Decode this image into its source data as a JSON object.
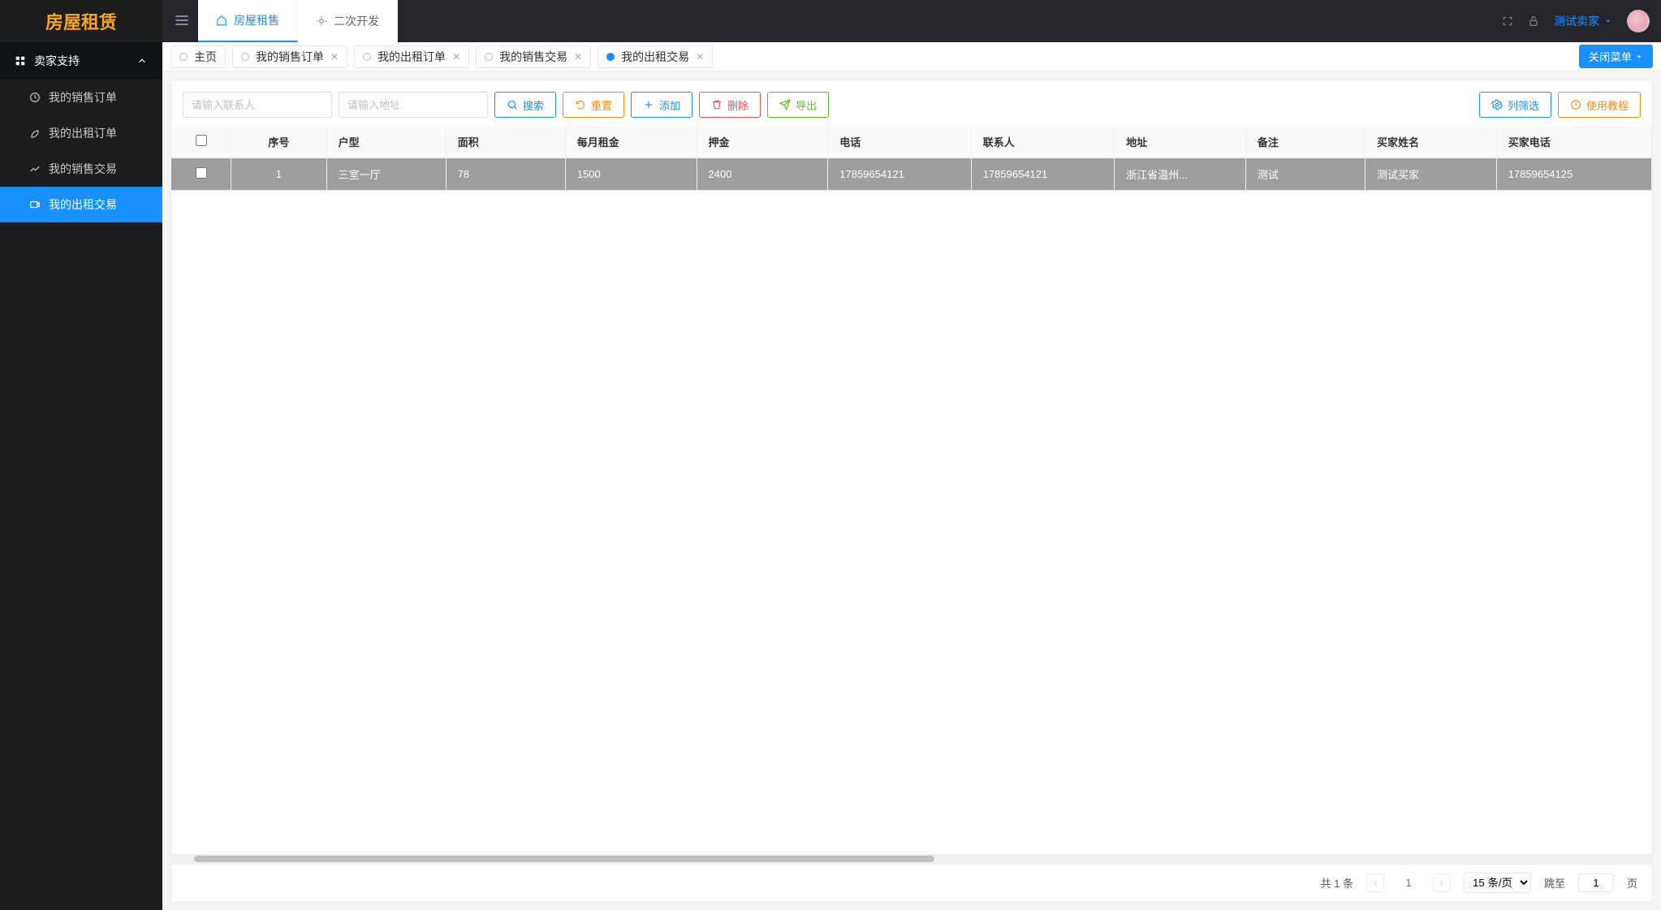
{
  "logo": "房屋租赁",
  "sidebar": {
    "group_label": "卖家支持",
    "items": [
      {
        "label": "我的销售订单"
      },
      {
        "label": "我的出租订单"
      },
      {
        "label": "我的销售交易"
      },
      {
        "label": "我的出租交易"
      }
    ]
  },
  "topnav": {
    "tabs": [
      {
        "label": "房屋租售",
        "active": true
      },
      {
        "label": "二次开发",
        "active": false
      }
    ]
  },
  "user": {
    "name": "测试卖家"
  },
  "pagetabs": {
    "close_menu": "关闭菜单",
    "items": [
      {
        "label": "主页",
        "closable": false
      },
      {
        "label": "我的销售订单",
        "closable": true
      },
      {
        "label": "我的出租订单",
        "closable": true
      },
      {
        "label": "我的销售交易",
        "closable": true
      },
      {
        "label": "我的出租交易",
        "closable": true,
        "active": true
      }
    ]
  },
  "search": {
    "contact_placeholder": "请输入联系人",
    "address_placeholder": "请输入地址"
  },
  "buttons": {
    "search": "搜索",
    "reset": "重置",
    "add": "添加",
    "delete": "删除",
    "export": "导出",
    "column_filter": "列筛选",
    "tutorial": "使用教程"
  },
  "table": {
    "headers": {
      "index": "序号",
      "house_type": "户型",
      "area": "面积",
      "monthly_rent": "每月租金",
      "deposit": "押金",
      "phone": "电话",
      "contact": "联系人",
      "address": "地址",
      "remark": "备注",
      "buyer_name": "买家姓名",
      "buyer_phone": "买家电话"
    },
    "rows": [
      {
        "index": "1",
        "house_type": "三室一厅",
        "area": "78",
        "monthly_rent": "1500",
        "deposit": "2400",
        "phone": "17859654121",
        "contact": "17859654121",
        "address": "浙江省温州...",
        "remark": "测试",
        "buyer_name": "测试买家",
        "buyer_phone": "17859654125"
      }
    ]
  },
  "pagination": {
    "total_text": "共 1 条",
    "current": "1",
    "page_size": "15 条/页",
    "jump_label": "跳至",
    "jump_value": "1",
    "jump_suffix": "页"
  }
}
